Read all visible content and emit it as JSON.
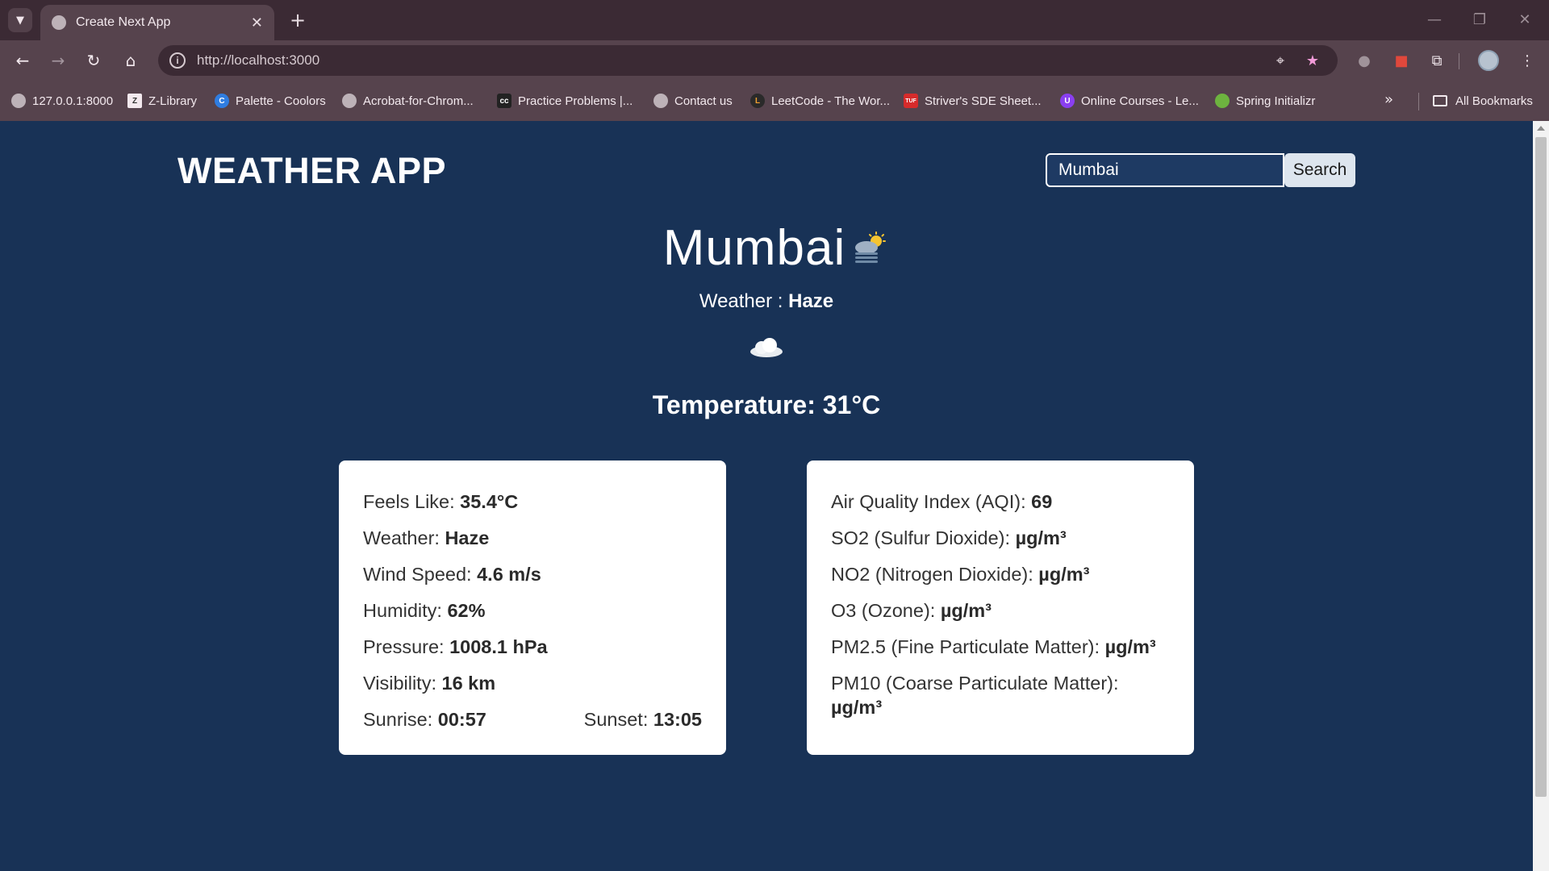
{
  "browser": {
    "tab_title": "Create Next App",
    "tab_close": "✕",
    "new_tab": "+",
    "url": "http://localhost:3000",
    "bookmarks": [
      "127.0.0.1:8000",
      "Z-Library",
      "Palette - Coolors",
      "Acrobat-for-Chrom...",
      "Practice Problems |...",
      "Contact us",
      "LeetCode - The Wor...",
      "Striver's SDE Sheet...",
      "Online Courses - Le...",
      "Spring Initializr"
    ],
    "all_bookmarks": "All Bookmarks",
    "icons": {
      "tab_search": "chevron-down-icon",
      "back": "back-arrow-icon",
      "forward": "forward-arrow-icon",
      "reload": "reload-icon",
      "home": "home-icon",
      "site_info": "info-icon",
      "location": "location-pin-icon",
      "bookmark_star": "star-icon",
      "extensions": "puzzle-icon",
      "menu": "kebab-menu-icon"
    },
    "colors": {
      "tab_strip": "#3b2a34",
      "toolbar": "#56434d",
      "star": "#f39bd9"
    }
  },
  "app": {
    "title": "WEATHER APP",
    "search": {
      "value": "Mumbai",
      "button_label": "Search"
    },
    "city": "Mumbai",
    "weather_label": "Weather : ",
    "weather_value": "Haze",
    "temperature_label": "Temperature: ",
    "temperature_value": "31°C",
    "background": "#183256"
  },
  "weather_card": {
    "feels_like": {
      "label": "Feels Like: ",
      "value": "35.4°C"
    },
    "weather": {
      "label": "Weather: ",
      "value": "Haze"
    },
    "wind_speed": {
      "label": "Wind Speed: ",
      "value": "4.6 m/s"
    },
    "humidity": {
      "label": "Humidity: ",
      "value": "62%"
    },
    "pressure": {
      "label": "Pressure: ",
      "value": "1008.1 hPa"
    },
    "visibility": {
      "label": "Visibility: ",
      "value": "16 km"
    },
    "sunrise": {
      "label": "Sunrise: ",
      "value": "00:57"
    },
    "sunset": {
      "label": "Sunset: ",
      "value": "13:05"
    }
  },
  "air_card": {
    "aqi": {
      "label": "Air Quality Index (AQI): ",
      "value": "69"
    },
    "so2": {
      "label": "SO2 (Sulfur Dioxide): ",
      "value": "µg/m³"
    },
    "no2": {
      "label": "NO2 (Nitrogen Dioxide): ",
      "value": "µg/m³"
    },
    "o3": {
      "label": "O3 (Ozone): ",
      "value": "µg/m³"
    },
    "pm25": {
      "label": "PM2.5 (Fine Particulate Matter): ",
      "value": "µg/m³"
    },
    "pm10": {
      "label": "PM10 (Coarse Particulate Matter): ",
      "value": "µg/m³"
    }
  }
}
